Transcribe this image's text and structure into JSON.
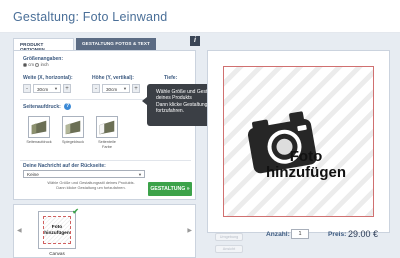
{
  "title": "Gestaltung: Foto Leinwand",
  "tabs": {
    "active": "PRODUKT OPTIONEN",
    "inactive": "GESTALTUNG FOTOS & TEXT"
  },
  "info_icon": "info-icon",
  "size": {
    "label": "Größenangaben:",
    "unit_cm": "cm",
    "unit_inch": "inch",
    "selected_unit": "cm",
    "width_label": "Weite (X, horizontal):",
    "height_label": "Höhe (Y, vertikal):",
    "depth_label": "Tiefe:",
    "width_value": "30cm",
    "height_value": "30cm"
  },
  "side_print": {
    "label": "Seitenaufdruck:",
    "options": [
      {
        "label": "Seitenaufdruck"
      },
      {
        "label": "Spiegeldruck"
      },
      {
        "label": "Seitenteile",
        "sublabel": "Farbe"
      }
    ]
  },
  "back_message": {
    "label": "Deine Nachricht auf der Rückseite:",
    "value": "Keine",
    "hint_line1": "Wähle Größe und Gestaltungsstil deines Produkts.",
    "hint_line2": "Dann klicke Gestaltung um fortzufahren."
  },
  "next_button": "GESTALTUNG »",
  "tooltip": {
    "line1": "Wähle Größe und Gestaltungsstil",
    "line2": "deines Produkts",
    "line3": "Dann klicke Gestaltung um",
    "line4": "fortzufahren."
  },
  "thumbs": {
    "items": [
      {
        "label": "Canvas",
        "photo_text_line1": "Foto",
        "photo_text_line2": "hinzufügen"
      }
    ]
  },
  "preview": {
    "photo_text_line1": "Foto",
    "photo_text_line2": "hinzufügen",
    "ghost_buttons": [
      "Umgebung",
      "Ansicht"
    ]
  },
  "order": {
    "qty_label": "Anzahl:",
    "qty_value": "1",
    "price_label": "Preis:",
    "price_value": "29.00 €"
  },
  "colors": {
    "title": "#4a6f98",
    "panel_bg": "#e7ecf2",
    "accent_green": "#3ca24a",
    "tab_dark": "#5c6c84",
    "tooltip_bg": "#3b3f45"
  }
}
